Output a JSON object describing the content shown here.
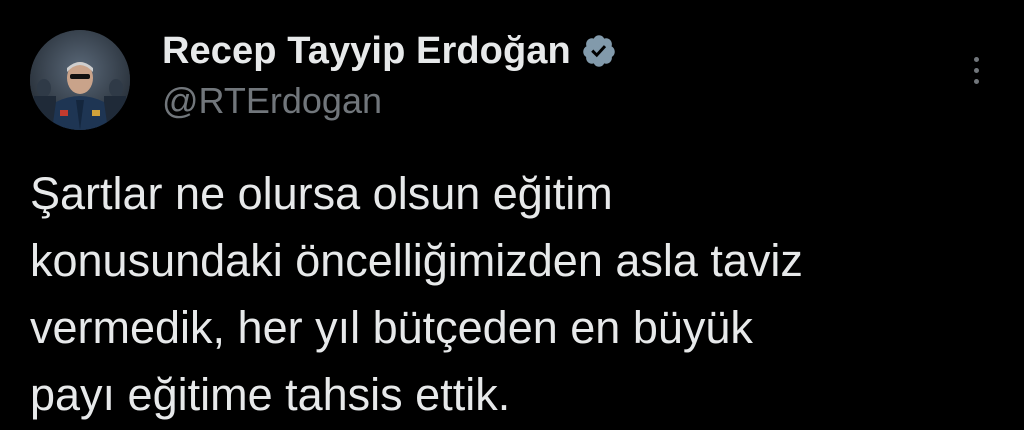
{
  "tweet": {
    "author": {
      "display_name": "Recep Tayyip Erdoğan",
      "handle": "@RTErdogan",
      "verified_icon": "verified-badge-icon",
      "avatar": "avatar-photo"
    },
    "more_icon": "more-options-icon",
    "text_lines": [
      "Şartlar ne olursa olsun eğitim",
      "konusundaki öncelliğimizden asla taviz",
      "vermedik, her yıl bütçeden en büyük",
      "payı eğitime tahsis ettik."
    ]
  },
  "colors": {
    "background": "#000000",
    "text_primary": "#e7e9ea",
    "text_secondary": "#71767b",
    "verified_badge": "#829aab"
  }
}
